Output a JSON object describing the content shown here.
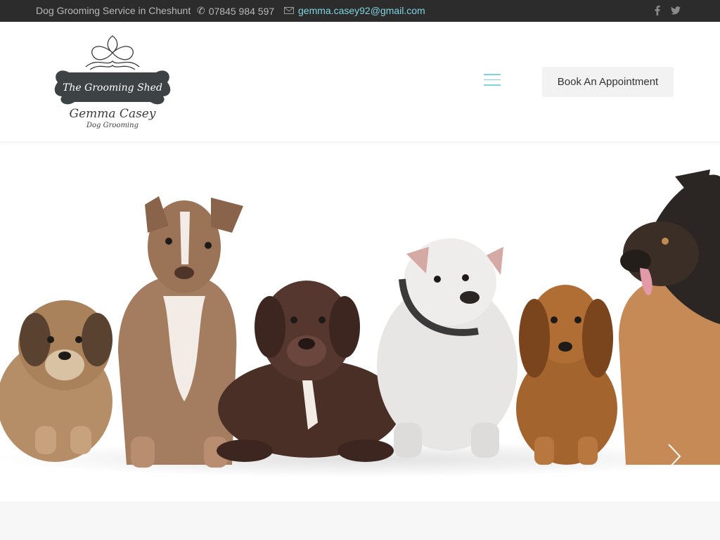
{
  "topbar": {
    "tagline": "Dog Grooming Service in Cheshunt",
    "phone": "07845 984 597",
    "email": "gemma.casey92@gmail.com",
    "social": [
      "facebook-icon",
      "twitter-icon"
    ]
  },
  "header": {
    "logo": {
      "banner_text": "The Grooming Shed",
      "name": "Gemma Casey",
      "subtitle": "Dog Grooming"
    },
    "menu_icon": "hamburger-menu-icon",
    "book_label": "Book An Appointment"
  },
  "hero": {
    "slide_next_icon": "chevron-right-icon"
  },
  "colors": {
    "topbar_bg": "#2c2c2c",
    "accent": "#7fd3e0",
    "button_bg": "#f2f2f2"
  }
}
